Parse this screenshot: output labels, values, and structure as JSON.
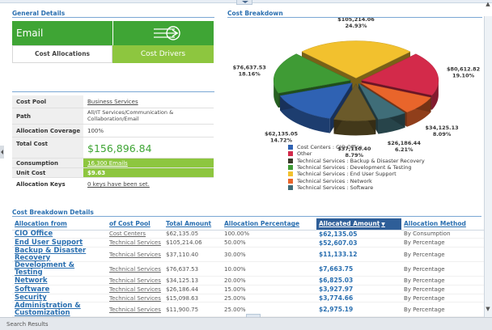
{
  "sections": {
    "general_details": "General Details",
    "cost_breakdown": "Cost Breakdown",
    "cost_breakdown_details": "Cost Breakdown Details"
  },
  "card": {
    "title": "Email",
    "tab_cost_allocations": "Cost Allocations",
    "tab_cost_drivers": "Cost Drivers",
    "driver_icon": "driver-arrow-icon"
  },
  "details": {
    "cost_pool_label": "Cost Pool",
    "cost_pool_value": "Business Services",
    "path_label": "Path",
    "path_value": "All/IT Services/Communication & Collaboration/Email",
    "coverage_label": "Allocation Coverage",
    "coverage_value": "100%",
    "total_cost_label": "Total Cost",
    "total_cost_value": "$156,896.84",
    "consumption_label": "Consumption",
    "consumption_value": "16,300 Emails",
    "unit_cost_label": "Unit Cost",
    "unit_cost_value": "$9.63",
    "allocation_keys_label": "Allocation Keys",
    "allocation_keys_value": "0 keys have been set."
  },
  "chart_data": {
    "type": "pie",
    "slices": [
      {
        "label": "Cost Centers : CIO Office",
        "amount": "$62,135.05",
        "percent": "14.72%",
        "value": 14.72,
        "color": "#2f62b3"
      },
      {
        "label": "Other",
        "amount": "$80,612.82",
        "percent": "19.10%",
        "value": 19.1,
        "color": "#d32a4a"
      },
      {
        "label": "Technical Services : Backup & Disaster Recovery",
        "amount": "$37,110.40",
        "percent": "8.79%",
        "value": 8.79,
        "color": "#6b5a2a"
      },
      {
        "label": "Technical Services : Development & Testing",
        "amount": "$76,637.53",
        "percent": "18.16%",
        "value": 18.16,
        "color": "#3f9b35"
      },
      {
        "label": "Technical Services : End User Support",
        "amount": "$105,214.06",
        "percent": "24.93%",
        "value": 24.93,
        "color": "#f2c12e"
      },
      {
        "label": "Technical Services : Network",
        "amount": "$34,125.13",
        "percent": "8.09%",
        "value": 8.09,
        "color": "#e9652b"
      },
      {
        "label": "Technical Services : Software",
        "amount": "$26,186.44",
        "percent": "6.21%",
        "value": 6.21,
        "color": "#3f6d78"
      }
    ],
    "legend_placement": "bottom"
  },
  "table": {
    "headers": [
      "Allocation from",
      "of Cost Pool",
      "Total Amount",
      "Allocation Percentage",
      "Allocated Amount",
      "Allocation Method"
    ],
    "rows": [
      [
        "CIO Office",
        "Cost Centers",
        "$62,135.05",
        "100.00%",
        "$62,135.05",
        "By Consumption"
      ],
      [
        "End User Support",
        "Technical Services",
        "$105,214.06",
        "50.00%",
        "$52,607.03",
        "By Percentage"
      ],
      [
        "Backup & Disaster Recovery",
        "Technical Services",
        "$37,110.40",
        "30.00%",
        "$11,133.12",
        "By Percentage"
      ],
      [
        "Development & Testing",
        "Technical Services",
        "$76,637.53",
        "10.00%",
        "$7,663.75",
        "By Percentage"
      ],
      [
        "Network",
        "Technical Services",
        "$34,125.13",
        "20.00%",
        "$6,825.03",
        "By Percentage"
      ],
      [
        "Software",
        "Technical Services",
        "$26,186.44",
        "15.00%",
        "$3,927.97",
        "By Percentage"
      ],
      [
        "Security",
        "Technical Services",
        "$15,098.63",
        "25.00%",
        "$3,774.66",
        "By Percentage"
      ],
      [
        "Administration & Customization",
        "Technical Services",
        "$11,900.75",
        "25.00%",
        "$2,975.19",
        "By Percentage"
      ]
    ]
  },
  "status_bar": "Search Results",
  "colors": {
    "accent": "#2a6fb0",
    "green_dark": "#3fa535",
    "green_light": "#8dc63f"
  }
}
